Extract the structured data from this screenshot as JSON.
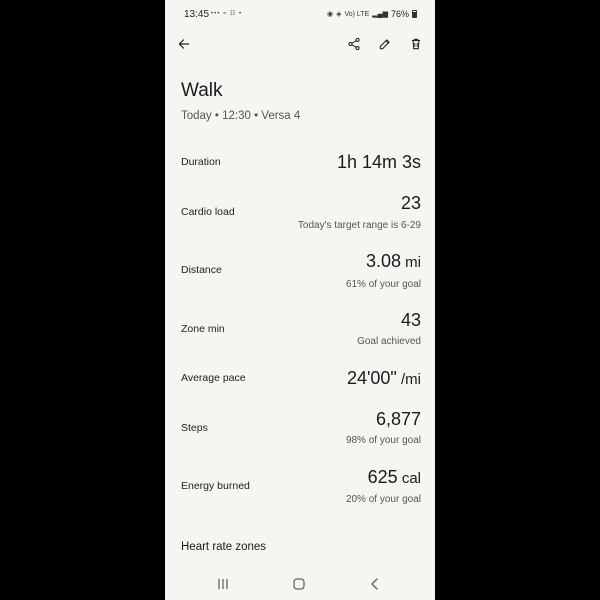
{
  "status_bar": {
    "time": "13:45",
    "left_icons": "••• ≈ ☷ •",
    "network": "Vo) LTE",
    "battery": "76%"
  },
  "app_bar": {
    "icons": [
      "back-arrow",
      "share",
      "edit-pencil",
      "delete-trash"
    ]
  },
  "header": {
    "title": "Walk",
    "subtitle": "Today • 12:30 • Versa 4"
  },
  "metrics": [
    {
      "label": "Duration",
      "value": "1h 14m 3s",
      "unit": "",
      "sub": ""
    },
    {
      "label": "Cardio load",
      "value": "23",
      "unit": "",
      "sub": "Today's target range is 6-29"
    },
    {
      "label": "Distance",
      "value": "3.08",
      "unit": " mi",
      "sub": "61% of your goal"
    },
    {
      "label": "Zone min",
      "value": "43",
      "unit": "",
      "sub": "Goal achieved"
    },
    {
      "label": "Average pace",
      "value": "24'00\"",
      "unit": " /mi",
      "sub": ""
    },
    {
      "label": "Steps",
      "value": "6,877",
      "unit": "",
      "sub": "98% of your goal"
    },
    {
      "label": "Energy burned",
      "value": "625",
      "unit": " cal",
      "sub": "20% of your goal"
    }
  ],
  "section": {
    "heading": "Heart rate zones"
  },
  "nav_bar": {
    "icons": [
      "recents",
      "home",
      "back"
    ]
  }
}
